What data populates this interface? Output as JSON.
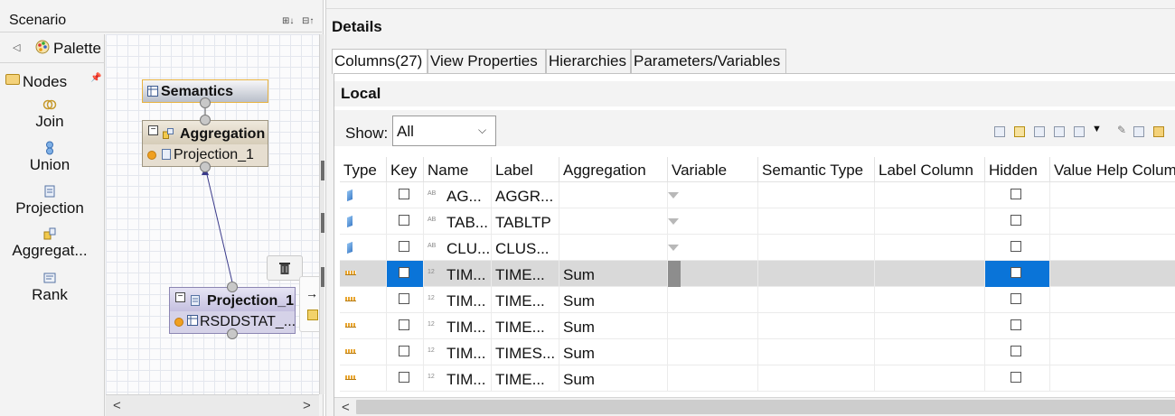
{
  "scenario": {
    "title": "Scenario",
    "palette_label": "Palette",
    "nodes_label": "Nodes",
    "tools": [
      {
        "label": "Join",
        "icon": "join-icon"
      },
      {
        "label": "Union",
        "icon": "union-icon"
      },
      {
        "label": "Projection",
        "icon": "projection-icon"
      },
      {
        "label": "Aggregat...",
        "icon": "aggregation-icon"
      },
      {
        "label": "Rank",
        "icon": "rank-icon"
      }
    ],
    "canvas": {
      "semantics_label": "Semantics",
      "aggregation_label": "Aggregation",
      "aggregation_input": "Projection_1",
      "projection_label": "Projection_1",
      "projection_input": "RSDDSTAT_..."
    }
  },
  "details": {
    "title": "Details",
    "tabs": [
      "Columns(27)",
      "View Properties",
      "Hierarchies",
      "Parameters/Variables"
    ],
    "section_title": "Local",
    "show_label": "Show:",
    "show_value": "All",
    "columns": [
      "Type",
      "Key",
      "Name",
      "Label",
      "Aggregation",
      "Variable",
      "Semantic Type",
      "Label Column",
      "Hidden",
      "Value Help Column"
    ],
    "rows": [
      {
        "type": "attribute",
        "dtype": "AB",
        "name": "AG...",
        "label": "AGGR...",
        "aggregation": "",
        "variable": true,
        "selected": false
      },
      {
        "type": "attribute",
        "dtype": "AB",
        "name": "TAB...",
        "label": "TABLTP",
        "aggregation": "",
        "variable": true,
        "selected": false
      },
      {
        "type": "attribute",
        "dtype": "AB",
        "name": "CLU...",
        "label": "CLUS...",
        "aggregation": "",
        "variable": true,
        "selected": false
      },
      {
        "type": "measure",
        "dtype": "12",
        "name": "TIM...",
        "label": "TIME...",
        "aggregation": "Sum",
        "variable": false,
        "selected": true
      },
      {
        "type": "measure",
        "dtype": "12",
        "name": "TIM...",
        "label": "TIME...",
        "aggregation": "Sum",
        "variable": false,
        "selected": false
      },
      {
        "type": "measure",
        "dtype": "12",
        "name": "TIM...",
        "label": "TIME...",
        "aggregation": "Sum",
        "variable": false,
        "selected": false
      },
      {
        "type": "measure",
        "dtype": "12",
        "name": "TIM...",
        "label": "TIMES...",
        "aggregation": "Sum",
        "variable": false,
        "selected": false
      },
      {
        "type": "measure",
        "dtype": "12",
        "name": "TIM...",
        "label": "TIME...",
        "aggregation": "Sum",
        "variable": false,
        "selected": false
      }
    ]
  }
}
